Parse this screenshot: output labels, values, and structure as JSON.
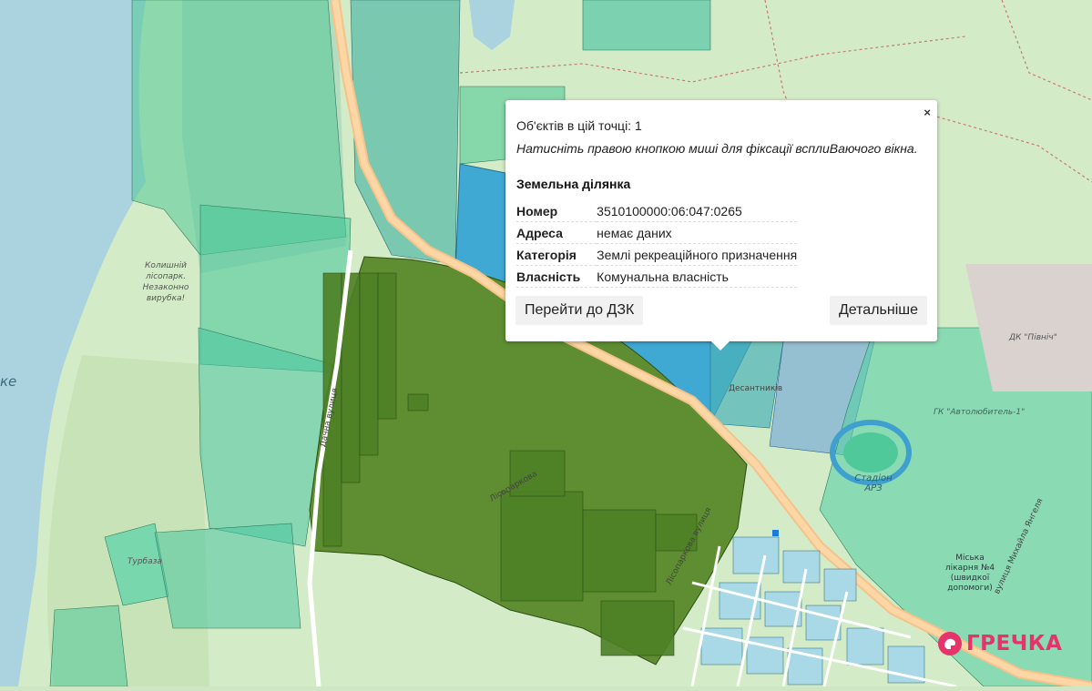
{
  "map": {
    "labels": {
      "forest": "Колишній лісопарк. Незаконно вирубка!",
      "lake_edge": "ке",
      "stadium": "Стадіон АРЗ",
      "garage_coop": "ГК \"Автолюбитель-1\"",
      "kindergarten": "ДК \"Північ\"",
      "hospital": "Міська лікарня №4 (швидкої допомоги)",
      "turbaza": "Турбаза",
      "street_1": "Лісопаркова вулиця",
      "street_2": "Десантників",
      "street_3": "вулиця Михайла Янгеля",
      "street_4": "Лісопаркова",
      "street_5": "Дачна вулиця"
    },
    "colors": {
      "selected_parcel": "#5e8e31",
      "highlight_parcel": "#3fa8d3",
      "cadastre_fill": "#40c9a0",
      "water": "#aad3df",
      "forest": "#acd39c"
    }
  },
  "popup": {
    "objects_count": "Об'єктів в цій точці: 1",
    "hint": "Натисніть правою кнопкою миші для фіксації всплиВаючого вікна.",
    "title": "Земельна ділянка",
    "rows": [
      {
        "key": "Номер",
        "value": "3510100000:06:047:0265"
      },
      {
        "key": "Адреса",
        "value": "немає даних"
      },
      {
        "key": "Категорія",
        "value": "Землі рекреаційного призначення"
      },
      {
        "key": "Власність",
        "value": "Комунальна власність"
      }
    ],
    "close_label": "×",
    "goto_button": "Перейти до ДЗК",
    "details_button": "Детальніше"
  },
  "brand": {
    "name": "ГРЕЧКА"
  }
}
